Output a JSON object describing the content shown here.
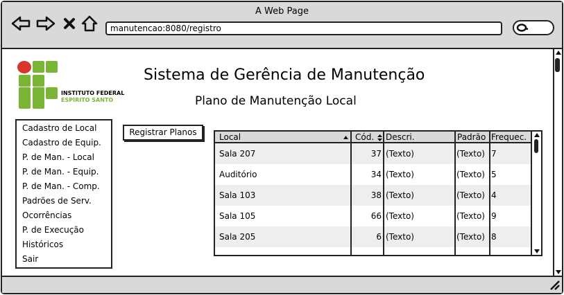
{
  "window": {
    "title": "A Web Page",
    "address": "manutencao:8080/registro"
  },
  "logo": {
    "line1": "INSTITUTO FEDERAL",
    "line2": "ESPÍRITO SANTO"
  },
  "header": {
    "title": "Sistema de Gerência de Manutenção",
    "subtitle": "Plano de Manutenção Local"
  },
  "menu": {
    "items": [
      "Cadastro de Local",
      "Cadastro de Equip.",
      "P. de Man. - Local",
      "P. de Man. - Equip.",
      "P. de Man. - Comp.",
      "Padrões de Serv.",
      "Ocorrências",
      "P. de Execução",
      "Históricos",
      "Sair"
    ]
  },
  "register_button": "Registrar Planos",
  "table": {
    "headers": [
      "Local",
      "Cód.",
      "Descri.",
      "Padrão",
      "Frequec."
    ],
    "rows": [
      [
        "Sala 207",
        "37",
        "(Texto)",
        "(Texto)",
        "7"
      ],
      [
        "Auditório",
        "34",
        "(Texto)",
        "(Texto)",
        "5"
      ],
      [
        "Sala 103",
        "38",
        "(Texto)",
        "(Texto)",
        "4"
      ],
      [
        "Sala 105",
        "66",
        "(Texto)",
        "(Texto)",
        "9"
      ],
      [
        "Sala 205",
        "6",
        "(Texto)",
        "(Texto)",
        "8"
      ]
    ],
    "row_colors": [
      "#eeeeee",
      "#ffffff"
    ]
  }
}
